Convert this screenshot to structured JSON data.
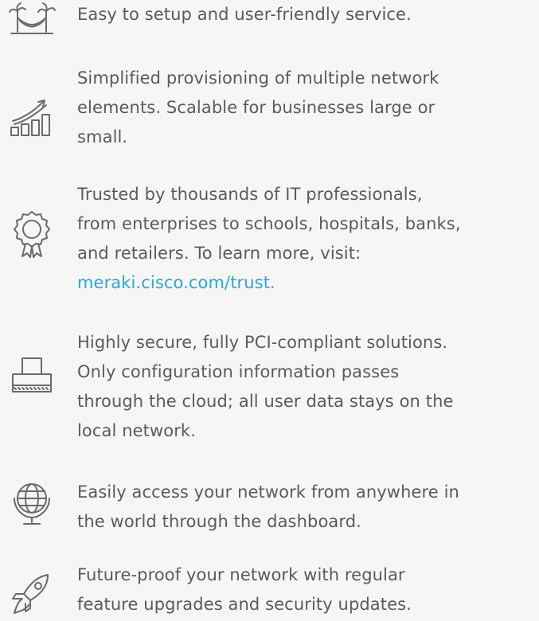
{
  "features": [
    {
      "icon": "hammock-icon",
      "lines": [
        "Easy to setup and user-friendly service."
      ]
    },
    {
      "icon": "growth-chart-icon",
      "lines": [
        "Simplified provisioning of multiple network",
        "elements. Scalable for businesses large or",
        "small."
      ]
    },
    {
      "icon": "award-ribbon-icon",
      "lines": [
        "Trusted by thousands of IT professionals,",
        "from enterprises to schools, hospitals, banks,",
        "and retailers. To learn more, visit:"
      ],
      "link": "meraki.cisco.com/trust."
    },
    {
      "icon": "secure-server-icon",
      "lines": [
        "Highly secure,  fully PCI-compliant solutions.",
        "Only configuration information passes",
        "through the cloud; all user data stays on the",
        "local network."
      ]
    },
    {
      "icon": "globe-icon",
      "lines": [
        "Easily access your network from anywhere in",
        "the world through the dashboard."
      ]
    },
    {
      "icon": "rocket-icon",
      "lines": [
        "Future-proof your network with regular",
        "feature upgrades and security updates."
      ]
    }
  ],
  "colors": {
    "text": "#5a5a5a",
    "link": "#2aa7d6",
    "background": "#f6f6f4",
    "icon_stroke": "#6a6a6a"
  }
}
